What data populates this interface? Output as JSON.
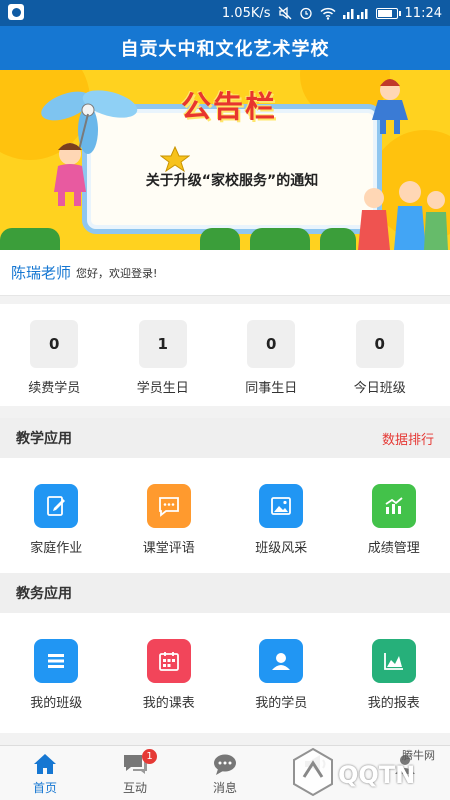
{
  "status_bar": {
    "speed": "1.05K/s",
    "time": "11:24"
  },
  "header": {
    "title": "自贡大中和文化艺术学校"
  },
  "banner": {
    "board_title": "公告栏",
    "notice": "关于升级“家校服务”的通知"
  },
  "greeting": {
    "name": "陈瑞老师",
    "text": "您好，欢迎登录!"
  },
  "stats": [
    {
      "value": "0",
      "label": "续费学员"
    },
    {
      "value": "1",
      "label": "学员生日"
    },
    {
      "value": "0",
      "label": "同事生日"
    },
    {
      "value": "0",
      "label": "今日班级"
    }
  ],
  "teaching": {
    "title": "教学应用",
    "link": "数据排行",
    "items": [
      {
        "label": "家庭作业",
        "icon": "edit-icon",
        "color": "#2196f3"
      },
      {
        "label": "课堂评语",
        "icon": "comment-icon",
        "color": "#ff9a2e"
      },
      {
        "label": "班级风采",
        "icon": "image-icon",
        "color": "#2196f3"
      },
      {
        "label": "成绩管理",
        "icon": "chart-icon",
        "color": "#43c24a"
      }
    ]
  },
  "admin": {
    "title": "教务应用",
    "items": [
      {
        "label": "我的班级",
        "icon": "list-icon",
        "color": "#2196f3"
      },
      {
        "label": "我的课表",
        "icon": "calendar-icon",
        "color": "#f2455a"
      },
      {
        "label": "我的学员",
        "icon": "user-icon",
        "color": "#2196f3"
      },
      {
        "label": "我的报表",
        "icon": "report-icon",
        "color": "#26b07a"
      }
    ]
  },
  "tabs": [
    {
      "label": "首页",
      "icon": "home-icon"
    },
    {
      "label": "互动",
      "icon": "chat-icon",
      "badge": "1"
    },
    {
      "label": "消息",
      "icon": "message-icon"
    },
    {
      "label": "",
      "icon": "megaphone-icon"
    },
    {
      "label": "",
      "icon": "profile-icon"
    }
  ],
  "watermark": {
    "brand": "QQTN",
    "site": "腾牛网"
  },
  "colors": {
    "primary": "#1677d2",
    "status": "#0f5ba3",
    "accent_red": "#e53935"
  }
}
